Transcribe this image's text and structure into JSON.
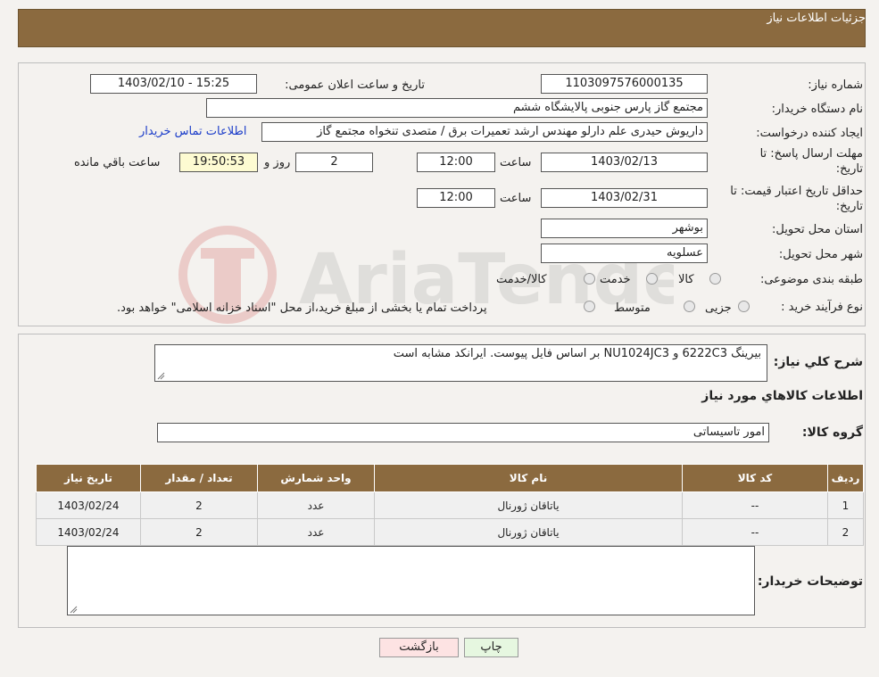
{
  "header": {
    "title": "جزئیات اطلاعات نیاز"
  },
  "form": {
    "need_number_label": "شماره نیاز:",
    "need_number": "1103097576000135",
    "announce_label": "تاریخ و ساعت اعلان عمومی:",
    "announce_value": "1403/02/10 - 15:25",
    "buyer_org_label": "نام دستگاه خریدار:",
    "buyer_org": "مجتمع گاز پارس جنوبی  پالایشگاه ششم",
    "creator_label": "ایجاد کننده درخواست:",
    "creator": "داریوش حیدری علم دارلو مهندس ارشد تعمیرات برق / متصدی تنخواه مجتمع گاز",
    "contact_link": "اطلاعات تماس خریدار",
    "deadline_label_1": "مهلت ارسال پاسخ: تا",
    "deadline_label_2": "تاریخ:",
    "deadline_date": "1403/02/13",
    "time_label": "ساعت",
    "deadline_time": "12:00",
    "days_value": "2",
    "days_label": "روز و",
    "remaining_time": "19:50:53",
    "remaining_label": "ساعت باقي مانده",
    "validity_label_1": "حداقل تاریخ اعتبار قیمت: تا",
    "validity_label_2": "تاریخ:",
    "validity_date": "1403/02/31",
    "validity_time": "12:00",
    "province_label": "استان محل تحویل:",
    "province": "بوشهر",
    "city_label": "شهر محل تحویل:",
    "city": "عسلویه",
    "category_label": "طبقه بندی موضوعی:",
    "category_options": [
      "کالا",
      "خدمت",
      "کالا/خدمت"
    ],
    "process_label": "نوع فرآیند خرید :",
    "process_options": [
      "جزیی",
      "متوسط"
    ],
    "process_note": "پرداخت تمام یا بخشی از مبلغ خرید،از محل \"اسناد خزانه اسلامی\" خواهد بود."
  },
  "details": {
    "desc_label": "شرح کلي نياز:",
    "desc_value": "بیرینگ 6222C3 و NU1024JC3 بر اساس فایل پیوست. ایرانکد مشابه است",
    "items_title": "اطلاعات کالاهاي مورد نياز",
    "group_label": "گروه کالا:",
    "group_value": "امور تاسیساتی",
    "table_headers": [
      "رديف",
      "کد کالا",
      "نام کالا",
      "واحد شمارش",
      "تعداد / مقدار",
      "تاریخ نیاز"
    ],
    "table_rows": [
      [
        "1",
        "--",
        "یاتاقان ژورنال",
        "عدد",
        "2",
        "1403/02/24"
      ],
      [
        "2",
        "--",
        "یاتاقان ژورنال",
        "عدد",
        "2",
        "1403/02/24"
      ]
    ],
    "buyer_notes_label": "توضیحات خریدار:",
    "buyer_notes_value": ""
  },
  "buttons": {
    "back": "بازگشت",
    "print": "چاپ"
  },
  "watermark": {
    "text": "AriaTender.neT"
  },
  "colors": {
    "header": "#8b6a3f",
    "back_button": "#fde3e3",
    "print_button": "#e6f7e0",
    "remaining_box": "#fdfbd2",
    "link": "#1a3cc9"
  }
}
